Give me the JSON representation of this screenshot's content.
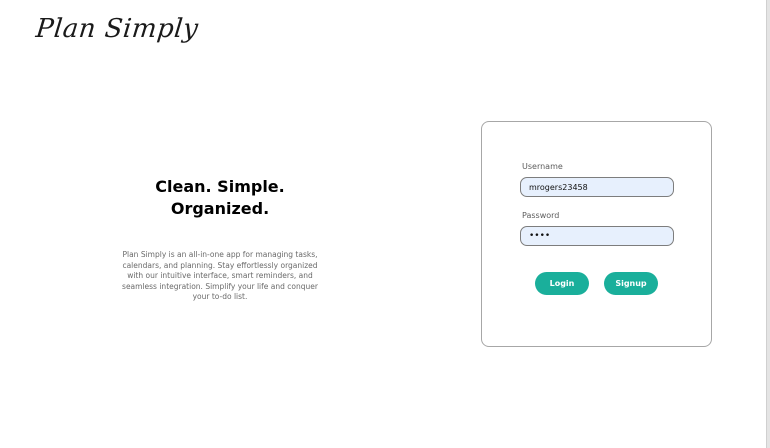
{
  "brand": {
    "logo_text": "Plan Simply"
  },
  "hero": {
    "title_line1": "Clean. Simple.",
    "title_line2": "Organized.",
    "description": "Plan Simply is an all-in-one app for managing tasks, calendars, and planning. Stay effortlessly organized with our intuitive interface, smart reminders, and seamless integration. Simplify your life and conquer your to-do list."
  },
  "login_form": {
    "username_label": "Username",
    "username_value": "mrogers23458",
    "password_label": "Password",
    "password_value": "abcd",
    "login_label": "Login",
    "signup_label": "Signup"
  },
  "colors": {
    "accent": "#1aaf9b",
    "input_bg": "#e7f0fd",
    "card_border": "#a7a7a7"
  }
}
